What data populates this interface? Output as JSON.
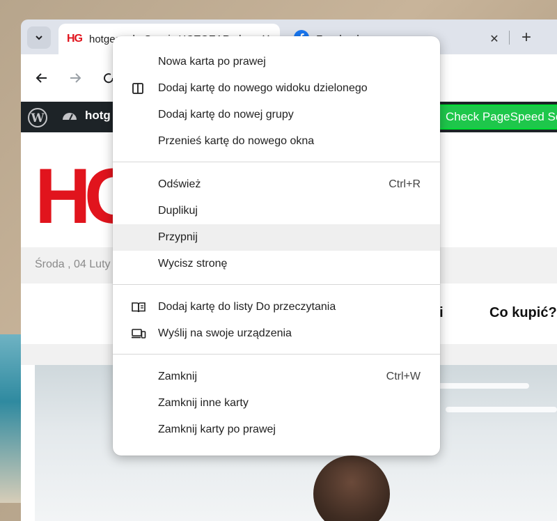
{
  "tabs": {
    "active": {
      "title": "hotgear.pl - Serwis HOTGEAR.pl",
      "favicon_text": "HG"
    },
    "inactive": {
      "title": "Facebook"
    },
    "new_tab_symbol": "+",
    "close_symbol": "✕"
  },
  "wp_admin_bar": {
    "site_name": "hotg",
    "pagespeed_label": "Check PageSpeed Sc"
  },
  "page": {
    "logo_text": "HG",
    "date_text": "Środa , 04 Luty",
    "nav_items": [
      "ci",
      "Co kupić?"
    ]
  },
  "context_menu": {
    "groups": [
      [
        {
          "label": "Nowa karta po prawej",
          "icon": "",
          "shortcut": ""
        },
        {
          "label": "Dodaj kartę do nowego widoku dzielonego",
          "icon": "split-view-icon",
          "shortcut": ""
        },
        {
          "label": "Dodaj kartę do nowej grupy",
          "icon": "",
          "shortcut": ""
        },
        {
          "label": "Przenieś kartę do nowego okna",
          "icon": "",
          "shortcut": ""
        }
      ],
      [
        {
          "label": "Odśwież",
          "icon": "",
          "shortcut": "Ctrl+R"
        },
        {
          "label": "Duplikuj",
          "icon": "",
          "shortcut": ""
        },
        {
          "label": "Przypnij",
          "icon": "",
          "shortcut": "",
          "highlighted": true
        },
        {
          "label": "Wycisz stronę",
          "icon": "",
          "shortcut": ""
        }
      ],
      [
        {
          "label": "Dodaj kartę do listy Do przeczytania",
          "icon": "reading-list-icon",
          "shortcut": ""
        },
        {
          "label": "Wyślij na swoje urządzenia",
          "icon": "devices-icon",
          "shortcut": ""
        }
      ],
      [
        {
          "label": "Zamknij",
          "icon": "",
          "shortcut": "Ctrl+W"
        },
        {
          "label": "Zamknij inne karty",
          "icon": "",
          "shortcut": ""
        },
        {
          "label": "Zamknij karty po prawej",
          "icon": "",
          "shortcut": ""
        }
      ]
    ]
  },
  "colors": {
    "brand_red": "#e1141d",
    "wp_bar": "#1d2327",
    "pagespeed_green": "#1ec74b",
    "menu_highlight": "#efefef"
  }
}
